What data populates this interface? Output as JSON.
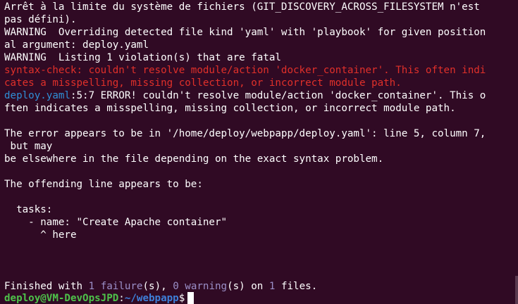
{
  "terminal": {
    "lines": {
      "l1": "Arrêt à la limite du système de fichiers (GIT_DISCOVERY_ACROSS_FILESYSTEM n'est",
      "l2": "pas défini).",
      "l3": "WARNING  Overriding detected file kind 'yaml' with 'playbook' for given position",
      "l4": "al argument: deploy.yaml",
      "l5": "WARNING  Listing 1 violation(s) that are fatal",
      "l6_prefix": "syntax-check:",
      "l6_rest": " couldn't resolve module/action 'docker_container'. This often indi",
      "l7": "cates a misspelling, missing collection, or incorrect module path.",
      "l8_file": "deploy.yaml",
      "l8_rest": ":5:7 ERROR! couldn't resolve module/action 'docker_container'. This o",
      "l9": "ften indicates a misspelling, missing collection, or incorrect module path.",
      "l11": "The error appears to be in '/home/deploy/webpapp/deploy.yaml': line 5, column 7,",
      "l12": " but may",
      "l13": "be elsewhere in the file depending on the exact syntax problem.",
      "l15": "The offending line appears to be:",
      "l17": "  tasks:",
      "l18": "    - name: \"Create Apache container\"",
      "l19": "      ^ here"
    },
    "summary": {
      "prefix": "Finished with ",
      "failures_count": "1",
      "failures_label": "failure",
      "suffix1": "(s), ",
      "warnings_count": "0",
      "warnings_label": "warning",
      "suffix2": "(s) on ",
      "files_count": "1",
      "suffix3": " files."
    },
    "prompt": {
      "user_host": "deploy@VM-DevOpsJPD",
      "colon": ":",
      "path": "~/webpapp",
      "symbol": "$"
    },
    "colors": {
      "background": "#300a24",
      "error_red": "#e0302a",
      "file_blue": "#2f8fd6",
      "count_purple": "#9b8fc8",
      "prompt_green": "#4ec24a",
      "prompt_path_blue": "#3e7fd9"
    }
  }
}
